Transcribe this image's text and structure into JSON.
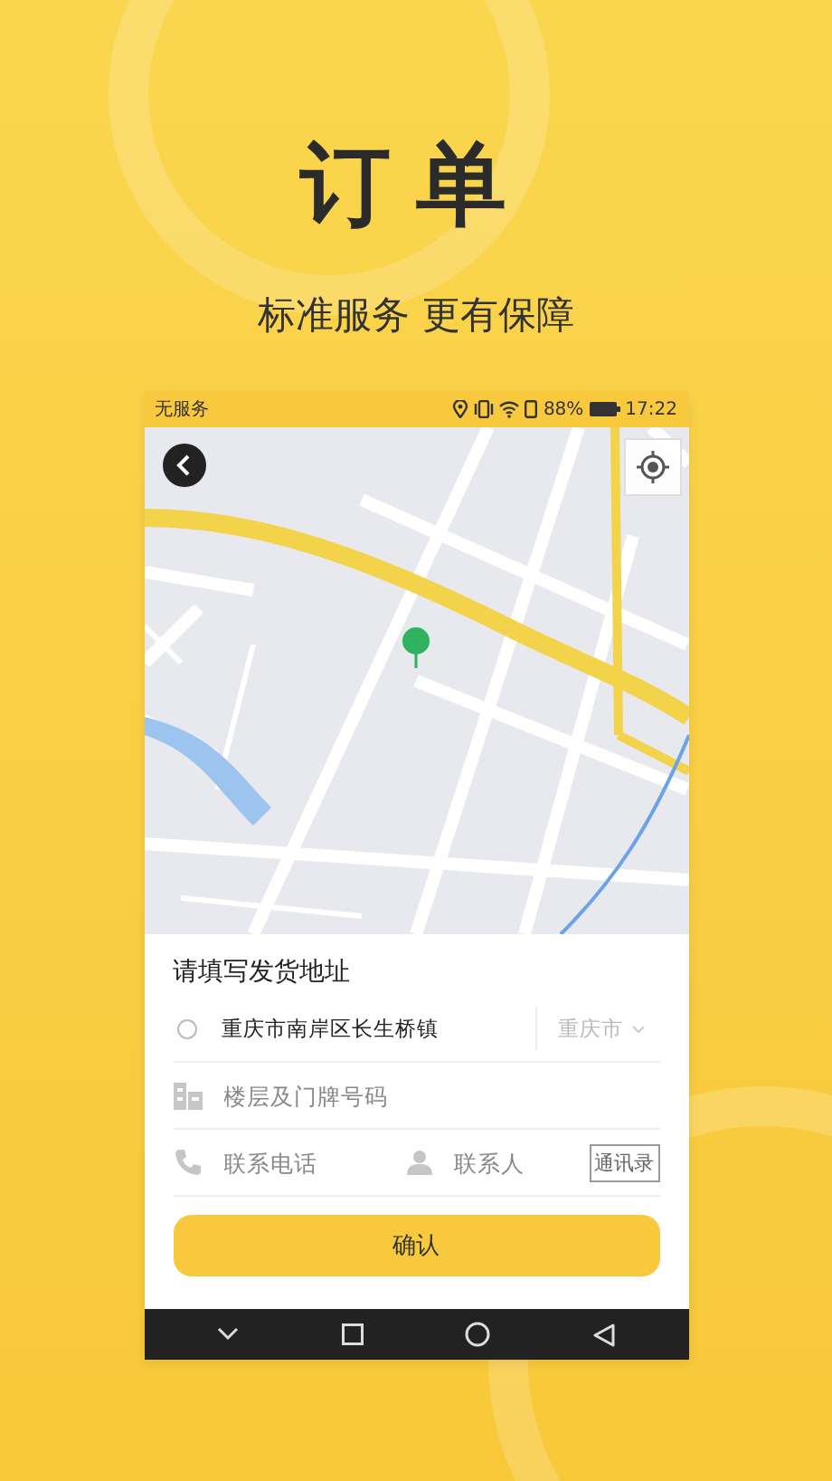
{
  "headline": "订单",
  "tagline": "标准服务 更有保障",
  "status_bar": {
    "carrier": "无服务",
    "battery": "88%",
    "time": "17:22"
  },
  "form": {
    "title": "请填写发货地址",
    "address": {
      "value": "重庆市南岸区长生桥镇",
      "selected": false
    },
    "city": "重庆市",
    "floor": {
      "placeholder": "楼层及门牌号码"
    },
    "phone": {
      "placeholder": "联系电话"
    },
    "contact": {
      "placeholder": "联系人"
    },
    "contacts_button": "通讯录",
    "confirm_button": "确认"
  }
}
